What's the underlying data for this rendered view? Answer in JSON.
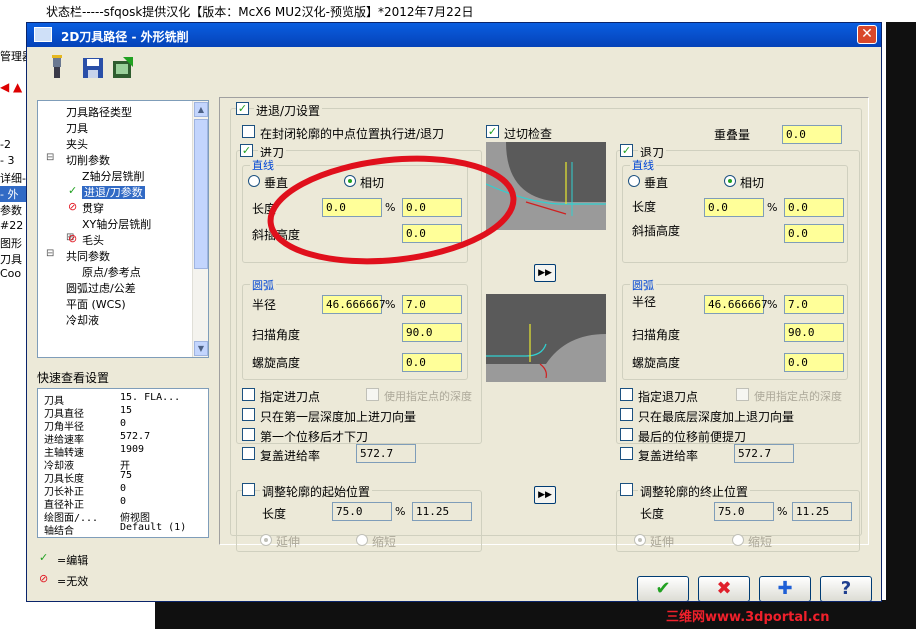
{
  "status_bar": {
    "text": "状态栏-----sfqosk提供汉化【版本：McX6 MU2汉化-预览版】*2012年7月22日"
  },
  "left_strip": {
    "lines": [
      "管理器",
      "-2",
      "- 3",
      "详细-",
      "- 外",
      "参数",
      "#22",
      "图形",
      "刀具",
      "Coo"
    ]
  },
  "dialog": {
    "title": "2D刀具路径 - 外形铣削",
    "close_label": "✕",
    "toolbar": {
      "icons": [
        "tool-flashlight-icon",
        "save-icon",
        "export-icon"
      ]
    },
    "tree": {
      "items": [
        {
          "label": "刀具路径类型",
          "indent": 0
        },
        {
          "label": "刀具",
          "indent": 0
        },
        {
          "label": "夹头",
          "indent": 0
        },
        {
          "label": "切削参数",
          "indent": 0,
          "expander": "⊟"
        },
        {
          "label": "Z轴分层铣削",
          "indent": 1
        },
        {
          "label": "进退/刀参数",
          "indent": 1,
          "selected": true,
          "mark": "✓"
        },
        {
          "label": "贯穿",
          "indent": 1,
          "mark": "⊘"
        },
        {
          "label": "XY轴分层铣削",
          "indent": 1
        },
        {
          "label": "毛头",
          "indent": 1,
          "expander": "⊞",
          "mark": "⊘"
        },
        {
          "label": "共同参数",
          "indent": 0,
          "expander": "⊟"
        },
        {
          "label": "原点/参考点",
          "indent": 1
        },
        {
          "label": "圆弧过虑/公差",
          "indent": 0
        },
        {
          "label": "平面 (WCS)",
          "indent": 0
        },
        {
          "label": "冷却液",
          "indent": 0
        }
      ]
    },
    "quick_view": {
      "title": "快速查看设置",
      "rows": [
        {
          "k": "刀具",
          "v": "15. FLA..."
        },
        {
          "k": "刀具直径",
          "v": "15"
        },
        {
          "k": "刀角半径",
          "v": "0"
        },
        {
          "k": "进给速率",
          "v": "572.7"
        },
        {
          "k": "主轴转速",
          "v": "1909"
        },
        {
          "k": "冷却液",
          "v": "开"
        },
        {
          "k": "刀具长度",
          "v": "75"
        },
        {
          "k": "刀长补正",
          "v": "0"
        },
        {
          "k": "直径补正",
          "v": "0"
        },
        {
          "k": "绘图面/...",
          "v": "俯视图"
        },
        {
          "k": "轴结合",
          "v": "Default (1)"
        }
      ]
    },
    "legend": {
      "edit": "=编辑",
      "invalid": "=无效"
    },
    "main": {
      "entry_exit_label": "进退/刀设置",
      "closed_midpoint_label": "在封闭轮廓的中点位置执行进/退刀",
      "gouge_check_label": "过切检查",
      "overlap_label": "重叠量",
      "overlap_value": "0.0",
      "entry": {
        "group_label": "进刀",
        "line": {
          "title": "直线",
          "perpendicular": "垂直",
          "tangent": "相切",
          "length_label": "长度",
          "length_pct": "0.0",
          "length_val": "0.0",
          "ramp_label": "斜插高度",
          "ramp_val": "0.0"
        },
        "arc": {
          "title": "圆弧",
          "radius_label": "半径",
          "radius_pct": "46.666667",
          "radius_val": "7.0",
          "sweep_label": "扫描角度",
          "sweep_val": "90.0",
          "helix_label": "螺旋高度",
          "helix_val": "0.0"
        },
        "specify_point": "指定进刀点",
        "use_point_depth": "使用指定点的深度",
        "first_depth_only": "只在第一层深度加上进刀向量",
        "first_move": "第一个位移后才下刀",
        "override_feed": "复盖进给率",
        "feed_val": "572.7",
        "adjust_start": "调整轮廓的起始位置",
        "adjust_length": "长度",
        "adjust_pct": "75.0",
        "adjust_val": "11.25",
        "extend": "延伸",
        "shorten": "缩短"
      },
      "exit": {
        "group_label": "退刀",
        "line": {
          "title": "直线",
          "perpendicular": "垂直",
          "tangent": "相切",
          "length_label": "长度",
          "length_pct": "0.0",
          "length_val": "0.0",
          "ramp_label": "斜插高度",
          "ramp_val": "0.0"
        },
        "arc": {
          "title": "圆弧",
          "radius_label": "半径",
          "radius_pct": "46.666667",
          "radius_val": "7.0",
          "sweep_label": "扫描角度",
          "sweep_val": "90.0",
          "helix_label": "螺旋高度",
          "helix_val": "0.0"
        },
        "specify_point": "指定退刀点",
        "use_point_depth": "使用指定点的深度",
        "last_depth_only": "只在最底层深度加上退刀向量",
        "last_move": "最后的位移前便提刀",
        "override_feed": "复盖进给率",
        "feed_val": "572.7",
        "adjust_end": "调整轮廓的终止位置",
        "adjust_length": "长度",
        "adjust_pct": "75.0",
        "adjust_val": "11.25",
        "extend": "延伸",
        "shorten": "缩短"
      },
      "pct_sign": "%",
      "copy_arrow": "▶▶"
    },
    "buttons": {
      "ok": "✔",
      "cancel": "✖",
      "add": "✚",
      "help": "?"
    }
  },
  "watermark": "三维网www.3dportal.cn",
  "colors": {
    "title_blue": "#0542b8",
    "input_yellow": "#ffff99",
    "annotation_red": "#e0101c",
    "group_blue": "#0046d5"
  }
}
